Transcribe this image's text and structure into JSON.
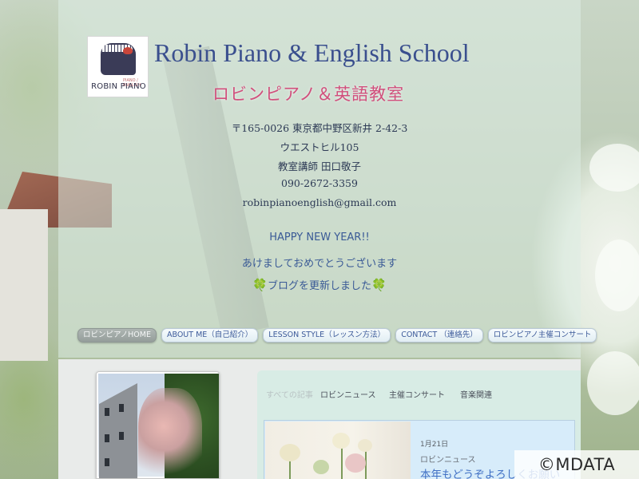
{
  "logo": {
    "small_text": "PIANO / ENGLISH",
    "text": "ROBIN PIANO"
  },
  "header": {
    "title": "Robin Piano & English School",
    "subtitle": "ロビンピアノ＆英語教室"
  },
  "contact": {
    "address1": "〒165-0026 東京都中野区新井 2-42-3",
    "address2": "ウエストヒル105",
    "teacher": "教室講師 田口敬子",
    "phone": "090-2672-3359",
    "email": "robinpianoenglish@gmail.com"
  },
  "announcement": {
    "line1": "HAPPY NEW YEAR!!",
    "line2": "あけましておめでとうございます",
    "line3": "ブログを更新しました",
    "clover_icon": "🍀"
  },
  "nav": {
    "items": [
      {
        "label": "ロビンピアノHOME",
        "active": true
      },
      {
        "label": "ABOUT ME（自己紹介）"
      },
      {
        "label": "LESSON STYLE（レッスン方法）"
      },
      {
        "label": "CONTACT （連絡先）"
      },
      {
        "label": "ロビンピアノ主催コンサート"
      }
    ]
  },
  "blog_tabs": {
    "items": [
      {
        "label": "すべての記事"
      },
      {
        "label": "ロビンニュース"
      },
      {
        "label": "主催コンサート"
      },
      {
        "label": "音楽関連"
      }
    ]
  },
  "post": {
    "date": "1月21日",
    "category": "ロビンニュース",
    "title": "本年もどうぞよろしくお願い"
  },
  "watermark": "©MDATA",
  "colors": {
    "title": "#3a4f8e",
    "subtitle": "#d14f7c",
    "nav_text": "#3d5b9a",
    "nav_active": "#9aa3a0",
    "post_title": "#3f6fc4"
  }
}
